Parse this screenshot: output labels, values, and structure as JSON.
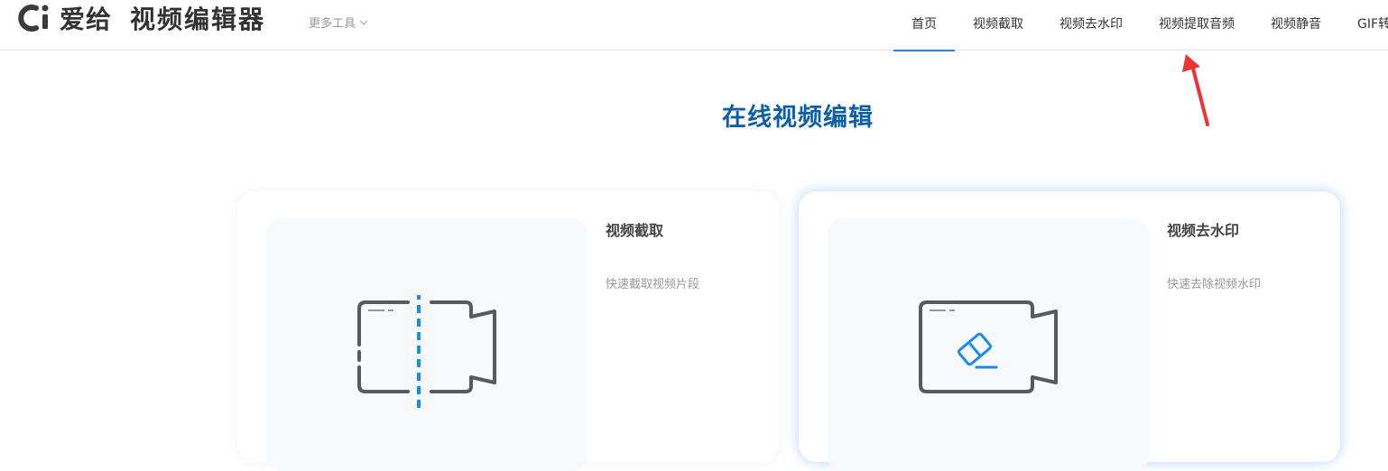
{
  "header": {
    "logo_brand": "爱给",
    "logo_product": "视频编辑器",
    "more_tools": "更多工具",
    "nav": [
      "首页",
      "视频截取",
      "视频去水印",
      "视频提取音频",
      "视频静音",
      "GIF转"
    ]
  },
  "main": {
    "title": "在线视频编辑",
    "cards": [
      {
        "title": "视频截取",
        "desc": "快速截取视频片段",
        "icon": "video-cut-icon"
      },
      {
        "title": "视频去水印",
        "desc": "快速去除视频水印",
        "icon": "video-eraser-icon"
      }
    ]
  },
  "colors": {
    "accent": "#1a8cf0",
    "title": "#0d5fa8",
    "arrow": "#ee3333"
  }
}
